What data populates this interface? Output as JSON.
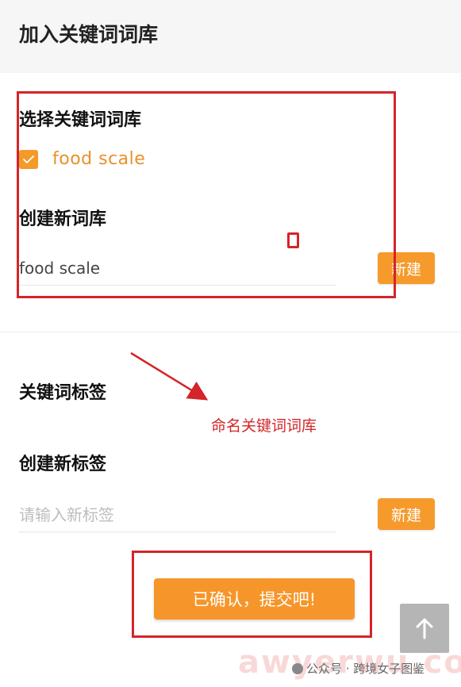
{
  "header": {
    "title": "加入关键词词库"
  },
  "keyword_library": {
    "select_title": "选择关键词词库",
    "option_label": "food scale",
    "option_checked": true,
    "create_title": "创建新词库",
    "input_value": "food scale",
    "new_button": "新建"
  },
  "tags": {
    "title": "关键词标签",
    "create_title": "创建新标签",
    "input_placeholder": "请输入新标签",
    "new_button": "新建"
  },
  "submit_button": "已确认，提交吧!",
  "annotation_text": "命名关键词词库",
  "watermark": {
    "text": "公众号 · 跨境女子图鉴",
    "site": "awyerwu.com"
  },
  "colors": {
    "accent": "#f69a2c",
    "annotation_red": "#d3252a",
    "scroll_button": "#b5b5b5"
  },
  "icons": {
    "checkbox": "check-icon",
    "scroll_top": "arrow-up-icon"
  }
}
